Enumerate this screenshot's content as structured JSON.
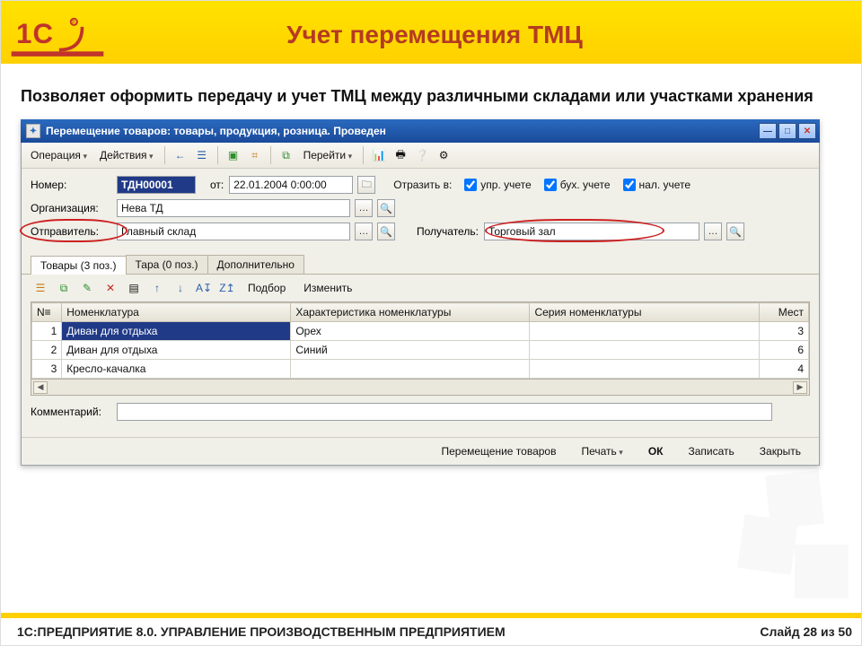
{
  "slide": {
    "title": "Учет перемещения ТМЦ",
    "description": "Позволяет оформить передачу и учет ТМЦ между различными складами или участками хранения",
    "footer_left": "1С:ПРЕДПРИЯТИЕ 8.0. УПРАВЛЕНИЕ ПРОИЗВОДСТВЕННЫМ ПРЕДПРИЯТИЕМ",
    "footer_right": "Слайд 28 из 50"
  },
  "window": {
    "title": "Перемещение товаров: товары, продукция, розница. Проведен",
    "toolbar": {
      "operation": "Операция",
      "actions": "Действия",
      "goto": "Перейти"
    },
    "form": {
      "number_label": "Номер:",
      "number_value": "ТДН00001",
      "from_label": "от:",
      "date_value": "22.01.2004  0:00:00",
      "reflect_label": "Отразить в:",
      "chk_upr": "упр. учете",
      "chk_buh": "бух. учете",
      "chk_nal": "нал. учете",
      "org_label": "Организация:",
      "org_value": "Нева ТД",
      "sender_label": "Отправитель:",
      "sender_value": "Главный склад",
      "receiver_label": "Получатель:",
      "receiver_value": "Торговый зал",
      "comment_label": "Комментарий:",
      "comment_value": ""
    },
    "tabs": [
      {
        "label": "Товары (3 поз.)",
        "active": true
      },
      {
        "label": "Тара (0 поз.)",
        "active": false
      },
      {
        "label": "Дополнительно",
        "active": false
      }
    ],
    "sub_toolbar": {
      "select": "Подбор",
      "change": "Изменить"
    },
    "grid": {
      "headers": [
        "N≡",
        "Номенклатура",
        "Характеристика номенклатуры",
        "Серия номенклатуры",
        "Мест"
      ],
      "rows": [
        {
          "n": "1",
          "name": "Диван для отдыха",
          "char": "Орех",
          "series": "",
          "places": "3"
        },
        {
          "n": "2",
          "name": "Диван для отдыха",
          "char": "Синий",
          "series": "",
          "places": "6"
        },
        {
          "n": "3",
          "name": "Кресло-качалка",
          "char": "",
          "series": "",
          "places": "4"
        }
      ]
    },
    "footer": {
      "move": "Перемещение товаров",
      "print": "Печать",
      "ok": "ОК",
      "save": "Записать",
      "close": "Закрыть"
    }
  }
}
